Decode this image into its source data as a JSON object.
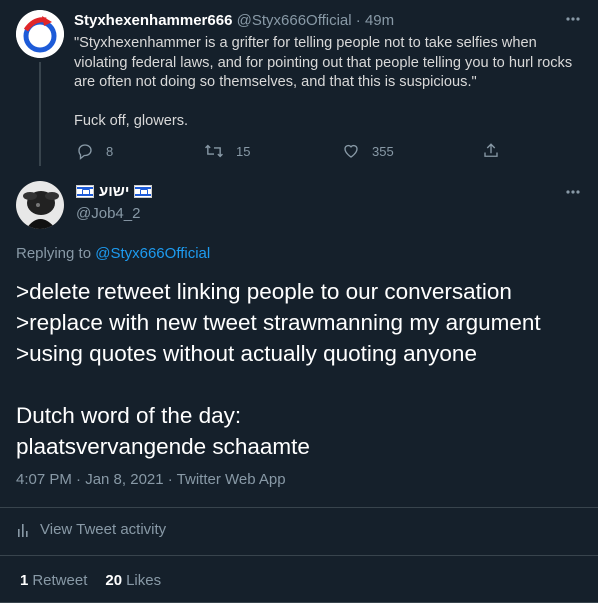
{
  "parent_tweet": {
    "author_name": "Styxhexenhammer666",
    "author_handle": "@Styx666Official",
    "age": "· 49m",
    "text": "\"Styxhexenhammer is a grifter for telling people not to take selfies when violating federal laws, and for pointing out that people telling you to hurl rocks are often not doing so themselves, and that this is suspicious.\"\n\nFuck off, glowers.",
    "reply_count": "8",
    "retweet_count": "15",
    "like_count": "355"
  },
  "main_tweet": {
    "author_name": "ישוע",
    "author_handle": "@Job4_2",
    "replying_label": "Replying to",
    "replying_to": "@Styx666Official",
    "text": ">delete retweet linking people to our conversation\n>replace with new tweet strawmanning my argument\n>using quotes without actually quoting anyone\n\nDutch word of the day:\nplaatsvervangende schaamte",
    "timestamp": "4:07 PM · Jan 8, 2021 · Twitter Web App",
    "activity_label": "View Tweet activity",
    "retweets_count": "1",
    "retweets_label": "Retweet",
    "likes_count": "20",
    "likes_label": "Likes"
  },
  "colors": {
    "background": "#15202b",
    "muted": "#8899a6",
    "accent": "#1d9bf0",
    "divider": "#38444d"
  }
}
